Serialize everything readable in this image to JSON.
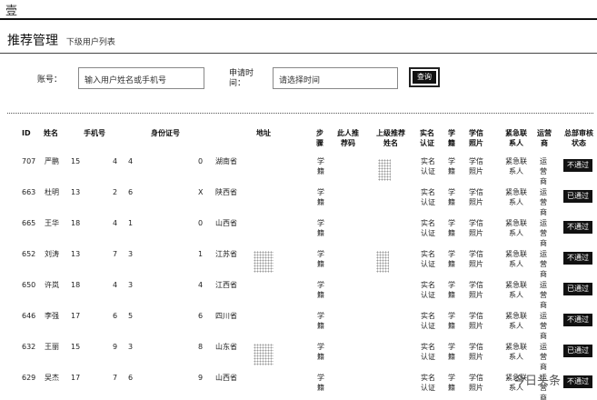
{
  "topbar": {
    "glyph": "壹"
  },
  "header": {
    "title": "推荐管理",
    "subtitle": "下级用户列表"
  },
  "search": {
    "account_label": "账号：",
    "account_placeholder": "输入用户姓名或手机号",
    "time_label": "申请时间：",
    "time_placeholder": "请选择时间",
    "button_label": "查询"
  },
  "table": {
    "headers": {
      "id": "ID",
      "name": "姓名",
      "phone": "手机号",
      "idcard": "身份证号",
      "address": "地址",
      "step": "步骤",
      "referrer": "此人推荐码",
      "parent_referrer": "上级推荐姓名",
      "realname": "实名认证",
      "student_id": "学籍",
      "xinxi_photo": "学信照片",
      "emergency": "紧急联系人",
      "operator": "运营商",
      "approval": "总部审核状态"
    },
    "rows": [
      {
        "id": "707",
        "name": "严鹏",
        "phone_a": "15",
        "phone_b": "4",
        "idcard_a": "4",
        "idcard_b": "0",
        "province": "湖南省",
        "step": "学籍",
        "realname": "实名认证",
        "student_id": "学籍",
        "xinxi_photo": "学信照片",
        "emergency": "紧急联系人",
        "operator": "运营商",
        "status": "不通过"
      },
      {
        "id": "663",
        "name": "杜明",
        "phone_a": "13",
        "phone_b": "2",
        "idcard_a": "6",
        "idcard_b": "X",
        "province": "陕西省",
        "step": "学籍",
        "realname": "实名认证",
        "student_id": "学籍",
        "xinxi_photo": "学信照片",
        "emergency": "紧急联系人",
        "operator": "运营商",
        "status": "已通过"
      },
      {
        "id": "665",
        "name": "王华",
        "phone_a": "18",
        "phone_b": "4",
        "idcard_a": "1",
        "idcard_b": "0",
        "province": "山西省",
        "step": "学籍",
        "realname": "实名认证",
        "student_id": "学籍",
        "xinxi_photo": "学信照片",
        "emergency": "紧急联系人",
        "operator": "运营商",
        "status": "不通过"
      },
      {
        "id": "652",
        "name": "刘涛",
        "phone_a": "13",
        "phone_b": "7",
        "idcard_a": "3",
        "idcard_b": "1",
        "province": "江苏省",
        "step": "学籍",
        "realname": "实名认证",
        "student_id": "学籍",
        "xinxi_photo": "学信照片",
        "emergency": "紧急联系人",
        "operator": "运营商",
        "status": "不通过"
      },
      {
        "id": "650",
        "name": "许岚",
        "phone_a": "18",
        "phone_b": "4",
        "idcard_a": "3",
        "idcard_b": "4",
        "province": "江西省",
        "step": "学籍",
        "realname": "实名认证",
        "student_id": "学籍",
        "xinxi_photo": "学信照片",
        "emergency": "紧急联系人",
        "operator": "运营商",
        "status": "已通过"
      },
      {
        "id": "646",
        "name": "李强",
        "phone_a": "17",
        "phone_b": "6",
        "idcard_a": "5",
        "idcard_b": "6",
        "province": "四川省",
        "step": "学籍",
        "realname": "实名认证",
        "student_id": "学籍",
        "xinxi_photo": "学信照片",
        "emergency": "紧急联系人",
        "operator": "运营商",
        "status": "不通过"
      },
      {
        "id": "632",
        "name": "王丽",
        "phone_a": "15",
        "phone_b": "9",
        "idcard_a": "3",
        "idcard_b": "8",
        "province": "山东省",
        "step": "学籍",
        "realname": "实名认证",
        "student_id": "学籍",
        "xinxi_photo": "学信照片",
        "emergency": "紧急联系人",
        "operator": "运营商",
        "status": "已通过"
      },
      {
        "id": "629",
        "name": "吴杰",
        "phone_a": "17",
        "phone_b": "7",
        "idcard_a": "6",
        "idcard_b": "9",
        "province": "山西省",
        "step": "学籍",
        "realname": "实名认证",
        "student_id": "学籍",
        "xinxi_photo": "学信照片",
        "emergency": "紧急联系人",
        "operator": "运营商",
        "status": "不通过"
      }
    ]
  },
  "watermark": "今日头条"
}
